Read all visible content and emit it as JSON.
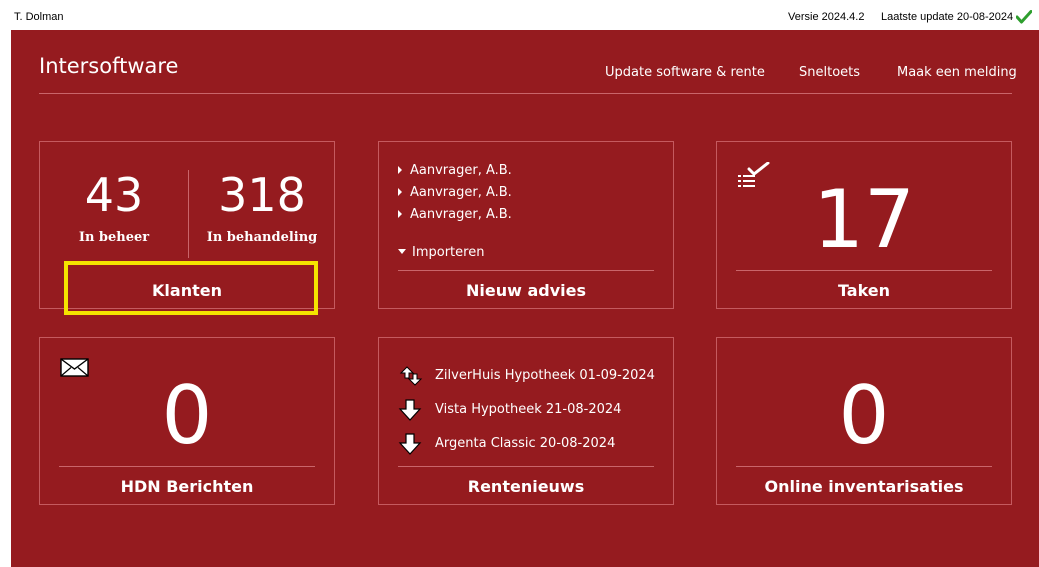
{
  "topbar": {
    "user": "T. Dolman",
    "version": "Versie 2024.4.2",
    "last_update": "Laatste update 20-08-2024"
  },
  "header": {
    "brand": "Intersoftware",
    "links": [
      "Update software & rente",
      "Sneltoets",
      "Maak een melding"
    ]
  },
  "tiles": {
    "klanten": {
      "title": "Klanten",
      "stats": [
        {
          "value": "43",
          "label": "In beheer"
        },
        {
          "value": "318",
          "label": "In behandeling"
        }
      ]
    },
    "nieuw_advies": {
      "title": "Nieuw advies",
      "items": [
        "Aanvrager, A.B.",
        "Aanvrager, A.B.",
        "Aanvrager, A.B."
      ],
      "import_label": "Importeren"
    },
    "taken": {
      "title": "Taken",
      "count": "17",
      "icon": "checklist-icon"
    },
    "hdn": {
      "title": "HDN Berichten",
      "count": "0",
      "icon": "envelope-icon"
    },
    "rentenieuws": {
      "title": "Rentenieuws",
      "items": [
        {
          "text": "ZilverHuis Hypotheek 01-09-2024",
          "icon": "rate-change-icon"
        },
        {
          "text": "Vista Hypotheek 21-08-2024",
          "icon": "arrow-down-icon"
        },
        {
          "text": "Argenta Classic 20-08-2024",
          "icon": "arrow-down-icon"
        }
      ]
    },
    "online": {
      "title": "Online inventarisaties",
      "count": "0"
    }
  },
  "colors": {
    "background": "#951b1f",
    "highlight": "#f5e400",
    "check": "#2e9e2e"
  }
}
